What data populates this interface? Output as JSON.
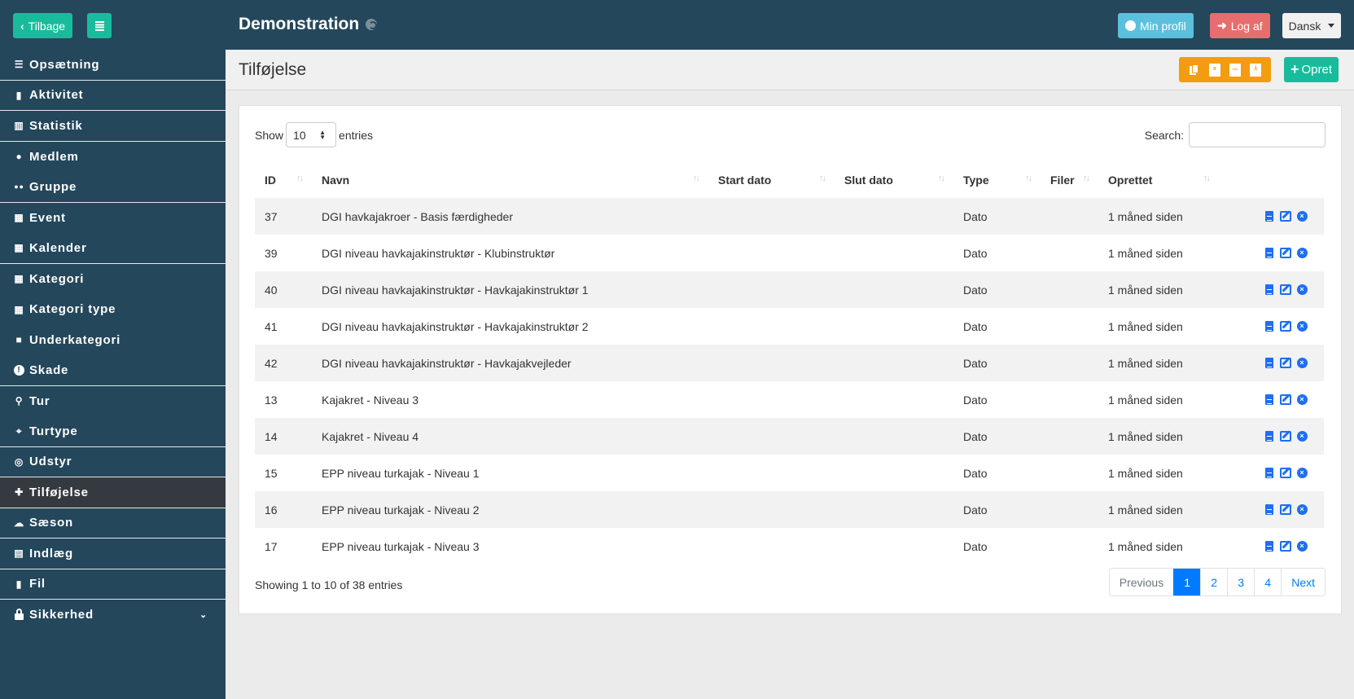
{
  "header": {
    "back_label": "Tilbage",
    "app_title": "Demonstration",
    "profile_label": "Min profil",
    "logout_label": "Log af",
    "language": "Dansk"
  },
  "sidebar": {
    "items": [
      {
        "label": "Opsætning",
        "icon": "list-check-icon",
        "glyph": "☰"
      },
      {
        "label": "Aktivitet",
        "icon": "bookmark-icon",
        "glyph": "▮"
      },
      {
        "label": "Statistik",
        "icon": "chart-bar-icon",
        "glyph": "▥"
      },
      {
        "label": "Medlem",
        "icon": "user-icon",
        "glyph": "●"
      },
      {
        "label": "Gruppe",
        "icon": "users-icon",
        "glyph": "●●"
      },
      {
        "label": "Event",
        "icon": "calendar-icon",
        "glyph": "▦"
      },
      {
        "label": "Kalender",
        "icon": "calendar-icon",
        "glyph": "▦"
      },
      {
        "label": "Kategori",
        "icon": "table-cells-icon",
        "glyph": "▦"
      },
      {
        "label": "Kategori type",
        "icon": "grid-icon",
        "glyph": "▦"
      },
      {
        "label": "Underkategori",
        "icon": "square-icon",
        "glyph": "■"
      },
      {
        "label": "Skade",
        "icon": "exclamation-circle-icon",
        "glyph": "!"
      },
      {
        "label": "Tur",
        "icon": "route-icon",
        "glyph": "⚲"
      },
      {
        "label": "Turtype",
        "icon": "map-location-icon",
        "glyph": "⌖"
      },
      {
        "label": "Udstyr",
        "icon": "life-ring-icon",
        "glyph": "◎"
      },
      {
        "label": "Tilføjelse",
        "icon": "puzzle-piece-icon",
        "glyph": "✚"
      },
      {
        "label": "Sæson",
        "icon": "cloud-sun-icon",
        "glyph": "☁"
      },
      {
        "label": "Indlæg",
        "icon": "book-icon",
        "glyph": "▤"
      },
      {
        "label": "Fil",
        "icon": "file-icon",
        "glyph": "▮"
      },
      {
        "label": "Sikkerhed",
        "icon": "lock-icon",
        "glyph": "🔒"
      }
    ],
    "active": "Tilføjelse"
  },
  "page": {
    "title": "Tilføjelse",
    "create_label": "Opret",
    "export_buttons": [
      "copy",
      "excel",
      "csv",
      "pdf"
    ]
  },
  "table": {
    "show_label": "Show",
    "entries_label": "entries",
    "page_size": "10",
    "search_label": "Search:",
    "search_value": "",
    "columns": [
      "ID",
      "Navn",
      "Start dato",
      "Slut dato",
      "Type",
      "Filer",
      "Oprettet"
    ],
    "rows": [
      {
        "id": "37",
        "navn": "DGI havkajakroer - Basis færdigheder",
        "start": "",
        "slut": "",
        "type": "Dato",
        "filer": "",
        "oprettet": "1 måned siden"
      },
      {
        "id": "39",
        "navn": "DGI niveau havkajakinstruktør - Klubinstruktør",
        "start": "",
        "slut": "",
        "type": "Dato",
        "filer": "",
        "oprettet": "1 måned siden"
      },
      {
        "id": "40",
        "navn": "DGI niveau havkajakinstruktør - Havkajakinstruktør 1",
        "start": "",
        "slut": "",
        "type": "Dato",
        "filer": "",
        "oprettet": "1 måned siden"
      },
      {
        "id": "41",
        "navn": "DGI niveau havkajakinstruktør - Havkajakinstruktør 2",
        "start": "",
        "slut": "",
        "type": "Dato",
        "filer": "",
        "oprettet": "1 måned siden"
      },
      {
        "id": "42",
        "navn": "DGI niveau havkajakinstruktør - Havkajakvejleder",
        "start": "",
        "slut": "",
        "type": "Dato",
        "filer": "",
        "oprettet": "1 måned siden"
      },
      {
        "id": "13",
        "navn": "Kajakret - Niveau 3",
        "start": "",
        "slut": "",
        "type": "Dato",
        "filer": "",
        "oprettet": "1 måned siden"
      },
      {
        "id": "14",
        "navn": "Kajakret - Niveau 4",
        "start": "",
        "slut": "",
        "type": "Dato",
        "filer": "",
        "oprettet": "1 måned siden"
      },
      {
        "id": "15",
        "navn": "EPP niveau turkajak - Niveau 1",
        "start": "",
        "slut": "",
        "type": "Dato",
        "filer": "",
        "oprettet": "1 måned siden"
      },
      {
        "id": "16",
        "navn": "EPP niveau turkajak - Niveau 2",
        "start": "",
        "slut": "",
        "type": "Dato",
        "filer": "",
        "oprettet": "1 måned siden"
      },
      {
        "id": "17",
        "navn": "EPP niveau turkajak - Niveau 3",
        "start": "",
        "slut": "",
        "type": "Dato",
        "filer": "",
        "oprettet": "1 måned siden"
      }
    ],
    "info": "Showing 1 to 10 of 38 entries",
    "pagination": {
      "previous": "Previous",
      "pages": [
        "1",
        "2",
        "3",
        "4"
      ],
      "current": "1",
      "next": "Next"
    }
  },
  "colors": {
    "header_bg": "#24475b",
    "accent_green": "#18bc9c",
    "export_orange": "#f39c12",
    "profile_blue": "#5bc0de",
    "logout_red": "#e76e6e",
    "active_sidebar": "#353a40",
    "link_blue": "#007bff"
  }
}
